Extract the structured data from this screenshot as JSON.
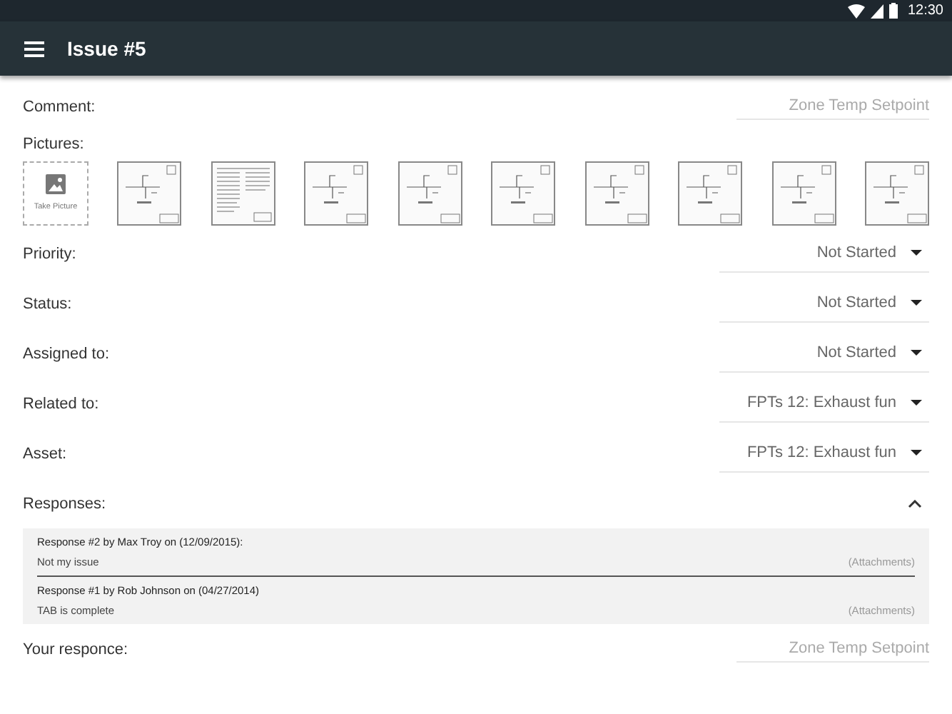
{
  "status_bar": {
    "time": "12:30"
  },
  "app_bar": {
    "title": "Issue #5"
  },
  "comment": {
    "label": "Comment:",
    "placeholder": "Zone Temp Setpoint"
  },
  "pictures": {
    "label": "Pictures:",
    "take_picture": "Take Picture",
    "thumbnails": [
      {
        "kind": "drawing"
      },
      {
        "kind": "text"
      },
      {
        "kind": "drawing"
      },
      {
        "kind": "drawing"
      },
      {
        "kind": "drawing"
      },
      {
        "kind": "drawing"
      },
      {
        "kind": "drawing"
      },
      {
        "kind": "drawing"
      },
      {
        "kind": "drawing"
      }
    ]
  },
  "dropdowns": [
    {
      "label": "Priority:",
      "value": "Not Started"
    },
    {
      "label": "Status:",
      "value": "Not Started"
    },
    {
      "label": "Assigned to:",
      "value": "Not Started"
    },
    {
      "label": "Related to:",
      "value": "FPTs 12: Exhaust fun"
    },
    {
      "label": "Asset:",
      "value": "FPTs 12: Exhaust fun"
    }
  ],
  "responses": {
    "label": "Responses:",
    "expanded": true,
    "items": [
      {
        "header": "Response #2 by Max Troy on (12/09/2015):",
        "text": "Not my issue",
        "attachments": "(Attachments)"
      },
      {
        "header": "Response #1 by Rob Johnson on (04/27/2014)",
        "text": "TAB is complete",
        "attachments": "(Attachments)"
      }
    ]
  },
  "your_response": {
    "label": "Your responce:",
    "placeholder": "Zone Temp Setpoint"
  }
}
